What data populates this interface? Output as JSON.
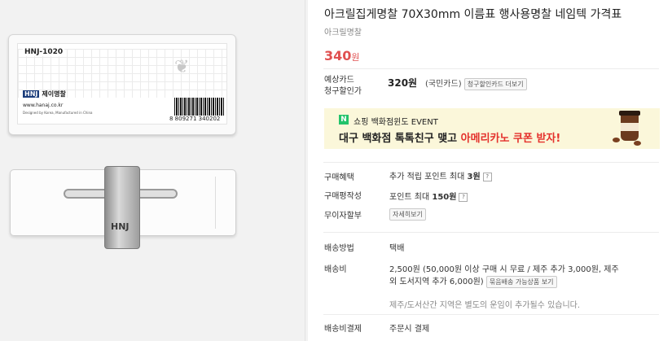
{
  "product": {
    "title": "아크릴집게명찰 70X30mm 이름표 행사용명찰 네임텍 가격표",
    "category": "아크릴명찰",
    "price_amount": "340",
    "price_unit": "원"
  },
  "card_discount": {
    "label_line1": "예상카드",
    "label_line2": "청구할인가",
    "price": "320원",
    "card_name": "(국민카드)",
    "more_button": "청구할인카드 더보기"
  },
  "banner": {
    "logo_letter": "N",
    "line1": "쇼핑 백화점윈도 EVENT",
    "line2_prefix": "대구 백화점 톡톡친구 맺고 ",
    "line2_highlight": "아메리카노 쿠폰 받자!"
  },
  "benefits": [
    {
      "label": "구매혜택",
      "value": "추가 적립 포인트 최대",
      "bold": "3원"
    },
    {
      "label": "구매평작성",
      "value": "포인트 최대",
      "bold": "150원"
    }
  ],
  "installment": {
    "label": "무이자할부",
    "button": "자세히보기"
  },
  "shipping": {
    "method_label": "배송방법",
    "method_value": "택배",
    "fee_label": "배송비",
    "fee_line1": "2,500원 (50,000원 이상 구매 시 무료 / 제주 추가 3,000원, 제주",
    "fee_line2": "외 도서지역 추가 6,000원)",
    "fee_button": "묶음배송 가능상품 보기",
    "notice": "제주/도서산간 지역은 별도의 운임이 추가될수 있습니다.",
    "payment_label": "배송비결제",
    "payment_value": "주문시 결제"
  },
  "image_card1": {
    "code": "HNJ-1020",
    "logo_mark": "HNJ",
    "logo_text": "제이명찰",
    "site": "www.hanaj.co.kr",
    "fine_print": "Designed by Korea, Manufactured in China",
    "barcode_number": "8 809271 340202"
  },
  "image_card2": {
    "clip_mark": "HNJ"
  },
  "icons": {
    "help": "?"
  }
}
